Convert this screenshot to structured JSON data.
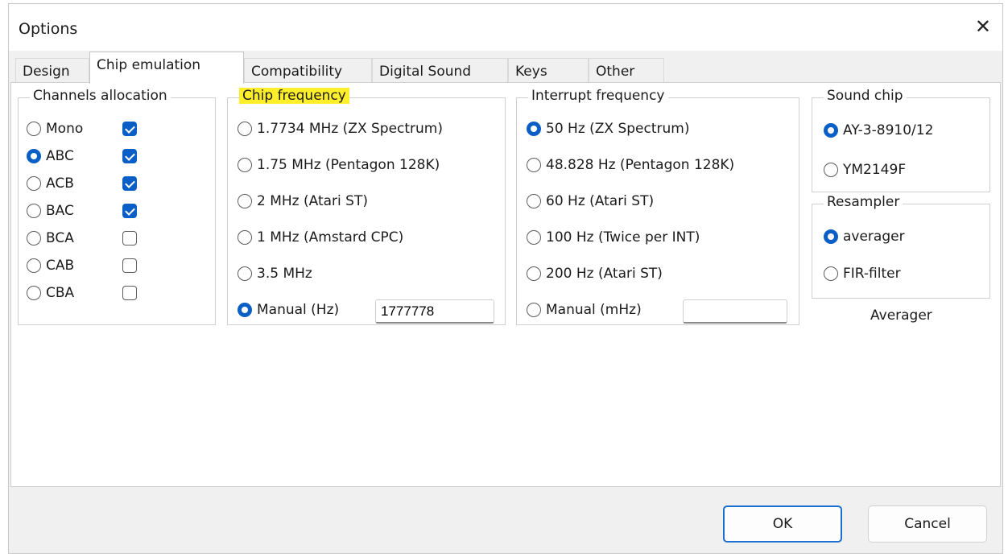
{
  "window": {
    "title": "Options"
  },
  "tabs": [
    {
      "label": "Design"
    },
    {
      "label": "Chip emulation"
    },
    {
      "label": "Compatibility"
    },
    {
      "label": "Digital Sound"
    },
    {
      "label": "Keys"
    },
    {
      "label": "Other"
    }
  ],
  "active_tab": "Chip emulation",
  "channels": {
    "title": "Channels allocation",
    "items": [
      {
        "label": "Mono",
        "selected": false,
        "checked": true
      },
      {
        "label": "ABC",
        "selected": true,
        "checked": true
      },
      {
        "label": "ACB",
        "selected": false,
        "checked": true
      },
      {
        "label": "BAC",
        "selected": false,
        "checked": true
      },
      {
        "label": "BCA",
        "selected": false,
        "checked": false
      },
      {
        "label": "CAB",
        "selected": false,
        "checked": false
      },
      {
        "label": "CBA",
        "selected": false,
        "checked": false
      }
    ]
  },
  "chip_frequency": {
    "title": "Chip frequency",
    "highlight_color": "#ffef2a",
    "options": [
      {
        "label": "1.7734 MHz (ZX Spectrum)",
        "selected": false
      },
      {
        "label": "1.75 MHz (Pentagon 128K)",
        "selected": false
      },
      {
        "label": "2 MHz (Atari ST)",
        "selected": false
      },
      {
        "label": "1 MHz (Amstard CPC)",
        "selected": false
      },
      {
        "label": "3.5 MHz",
        "selected": false
      },
      {
        "label": "Manual (Hz)",
        "selected": true
      }
    ],
    "manual_value": "1777778"
  },
  "interrupt_frequency": {
    "title": "Interrupt frequency",
    "options": [
      {
        "label": "50 Hz (ZX Spectrum)",
        "selected": true
      },
      {
        "label": "48.828 Hz (Pentagon 128K)",
        "selected": false
      },
      {
        "label": "60 Hz (Atari ST)",
        "selected": false
      },
      {
        "label": "100 Hz (Twice per INT)",
        "selected": false
      },
      {
        "label": "200 Hz (Atari ST)",
        "selected": false
      },
      {
        "label": "Manual (mHz)",
        "selected": false
      }
    ],
    "manual_value": ""
  },
  "sound_chip": {
    "title": "Sound chip",
    "options": [
      {
        "label": "AY-3-8910/12",
        "selected": true
      },
      {
        "label": "YM2149F",
        "selected": false
      }
    ]
  },
  "resampler": {
    "title": "Resampler",
    "options": [
      {
        "label": "averager",
        "selected": true
      },
      {
        "label": "FIR-filter",
        "selected": false
      }
    ],
    "status": "Averager"
  },
  "buttons": {
    "ok": "OK",
    "cancel": "Cancel"
  },
  "colors": {
    "accent": "#0a5fc6",
    "default_button_border": "#1a6fd0"
  }
}
